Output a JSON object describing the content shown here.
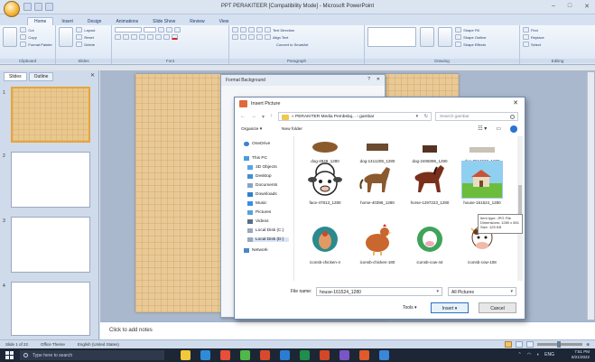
{
  "window": {
    "title": "PPT PERAKITEER [Compatibility Mode] - Microsoft PowerPoint",
    "controls": [
      "–",
      "□",
      "✕"
    ]
  },
  "ribbon": {
    "tabs": [
      "Home",
      "Insert",
      "Design",
      "Animations",
      "Slide Show",
      "Review",
      "View"
    ],
    "active_tab": "Home",
    "groups": [
      "Clipboard",
      "Slides",
      "Font",
      "Paragraph",
      "Drawing",
      "Editing"
    ],
    "clipboard": {
      "paste": "Paste",
      "cut": "Cut",
      "copy": "Copy",
      "format_painter": "Format Painter"
    },
    "slides": {
      "new_slide": "New Slide",
      "layout": "Layout",
      "reset": "Reset",
      "delete": "Delete"
    },
    "drawing": {
      "arrange": "Arrange",
      "quick_styles": "Quick Styles",
      "shape_fill": "Shape Fill",
      "shape_outline": "Shape Outline",
      "shape_effects": "Shape Effects"
    },
    "editing": {
      "find": "Find",
      "replace": "Replace",
      "select": "Select"
    },
    "paragraph": {
      "text_direction": "Text Direction",
      "align_text": "Align Text",
      "convert_smartart": "Convert to SmartArt"
    }
  },
  "left_panel": {
    "tabs": [
      "Slides",
      "Outline"
    ],
    "slide_numbers": [
      "1",
      "2",
      "3",
      "4"
    ]
  },
  "notes_placeholder": "Click to add notes",
  "status_bar": {
    "slide_info": "Slide 1 of 22",
    "theme": "Office Theme",
    "language": "English (United States)"
  },
  "format_background": {
    "title": "Format Background",
    "help": "?",
    "close": "✕"
  },
  "insert_picture": {
    "title": "Insert Picture",
    "path": "« PERAKITER Media Pembelaj... › gambar",
    "search_placeholder": "Search gambar",
    "organize": "Organize ▾",
    "new_folder": "New folder",
    "nav_items": [
      "OneDrive",
      "This PC",
      "3D Objects",
      "Desktop",
      "Documents",
      "Downloads",
      "Music",
      "Pictures",
      "Videos",
      "Local Disk (C:)",
      "Local Disk (D:)",
      "Network"
    ],
    "files": [
      {
        "name": "dog-4849_1280"
      },
      {
        "name": "dog-1411208_1280"
      },
      {
        "name": "dog-2406096_1280"
      },
      {
        "name": "dog-3564628_1280"
      },
      {
        "name": "face-47813_1280"
      },
      {
        "name": "horse-40396_1280"
      },
      {
        "name": "horse-1297223_1280"
      },
      {
        "name": "house-161524_1280"
      },
      {
        "name": "iconsb-chicken-4"
      },
      {
        "name": "iconsb-chicken-180"
      },
      {
        "name": "iconsb-cow-44"
      },
      {
        "name": "iconsb-cow-108"
      }
    ],
    "selected_file": "house-161524_1280",
    "tooltip": [
      "Item type: JPG File",
      "Dimensions: 1280 x 851",
      "Size: 129 KB"
    ],
    "file_name_label": "File name:",
    "file_name_value": "house-161524_1280",
    "file_type": "All Pictures",
    "tools": "Tools ▾",
    "insert": "Insert",
    "cancel": "Cancel"
  },
  "taskbar": {
    "search_placeholder": "Type here to search",
    "time": "7:51 PM",
    "date": "6/21/2022",
    "lang": "ENG"
  }
}
